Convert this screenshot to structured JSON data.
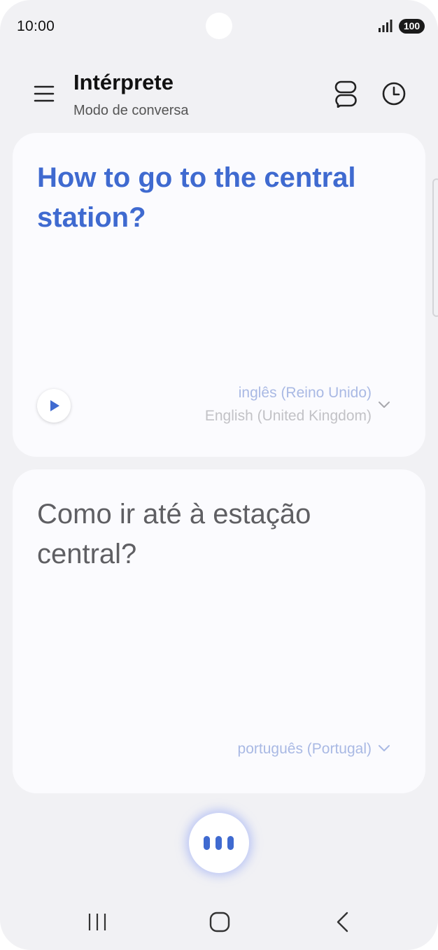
{
  "status_bar": {
    "time": "10:00",
    "battery": "100"
  },
  "header": {
    "title": "Intérprete",
    "subtitle": "Modo de conversa"
  },
  "source_card": {
    "text": "How to go to the central station?",
    "language_primary": "inglês (Reino Unido)",
    "language_secondary": "English (United Kingdom)"
  },
  "target_card": {
    "text": "Como ir até à estação central?",
    "language_primary": "português (Portugal)"
  },
  "icons": {
    "menu": "menu-icon",
    "mode": "conversation-mode-icon",
    "history": "clock-icon",
    "play": "play-icon",
    "mic": "voice-input-icon",
    "recent": "recent-apps-icon",
    "home": "home-icon",
    "back": "back-icon"
  },
  "colors": {
    "accent": "#3f6ad0",
    "background": "#f1f1f4",
    "card": "#fbfbfe",
    "language_label": "#a9b9e4"
  }
}
